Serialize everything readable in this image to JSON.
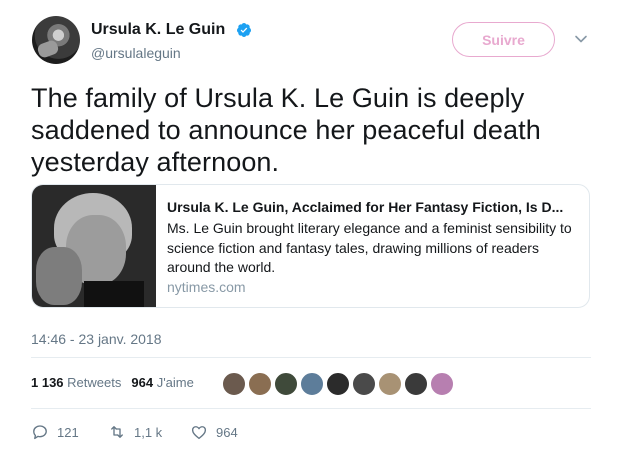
{
  "author": {
    "name": "Ursula K. Le Guin",
    "handle": "@ursulaleguin",
    "avatar_icon": "author-avatar",
    "verified_icon": "verified-badge-icon",
    "verified_color": "#1da1f2"
  },
  "header": {
    "follow_label": "Suivre",
    "follow_color": "#e8a9cf",
    "menu_icon": "chevron-down-icon"
  },
  "tweet": {
    "text": "The family of Ursula K. Le Guin is deeply saddened to announce her peaceful death yesterday afternoon."
  },
  "card": {
    "title": "Ursula K. Le Guin, Acclaimed for Her Fantasy Fiction, Is D...",
    "description": "Ms. Le Guin brought literary elegance and a feminist sensibility to science fiction and fantasy tales, drawing millions of readers around the world.",
    "domain": "nytimes.com",
    "image_icon": "article-photo"
  },
  "timestamp": "14:46 - 23 janv. 2018",
  "stats": {
    "retweets_count": "1 136",
    "retweets_label": "Retweets",
    "likes_count": "964",
    "likes_label": "J'aime"
  },
  "likers": [
    {
      "name": "liker-avatar",
      "color": "#6b5a4e"
    },
    {
      "name": "liker-avatar",
      "color": "#8a6e52"
    },
    {
      "name": "liker-avatar",
      "color": "#3f4a3a"
    },
    {
      "name": "liker-avatar",
      "color": "#5d7d9a"
    },
    {
      "name": "liker-avatar",
      "color": "#2b2b2b"
    },
    {
      "name": "liker-avatar",
      "color": "#4a4a4a"
    },
    {
      "name": "liker-avatar",
      "color": "#a89274"
    },
    {
      "name": "liker-avatar",
      "color": "#3a3a3a"
    },
    {
      "name": "liker-avatar",
      "color": "#b77fb0"
    }
  ],
  "actions": {
    "reply_count": "121",
    "retweet_count": "1,1 k",
    "like_count": "964",
    "reply_icon": "reply-icon",
    "retweet_icon": "retweet-icon",
    "like_icon": "heart-icon"
  }
}
